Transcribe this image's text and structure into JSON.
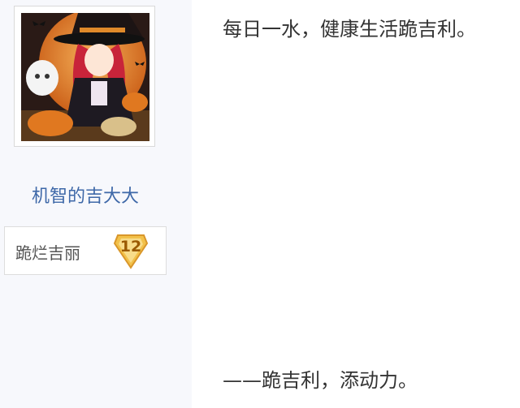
{
  "author": {
    "username": "机智的吉大大",
    "badge_title": "跪烂吉丽",
    "level": "12"
  },
  "post": {
    "line1": "每日一水，健康生活跪吉利。",
    "line2": "——跪吉利，添动力。"
  },
  "colors": {
    "sidebar_bg": "#f7f8fc",
    "username_link": "#3e68a8",
    "badge_gold": "#f2c14a",
    "text": "#333333"
  }
}
